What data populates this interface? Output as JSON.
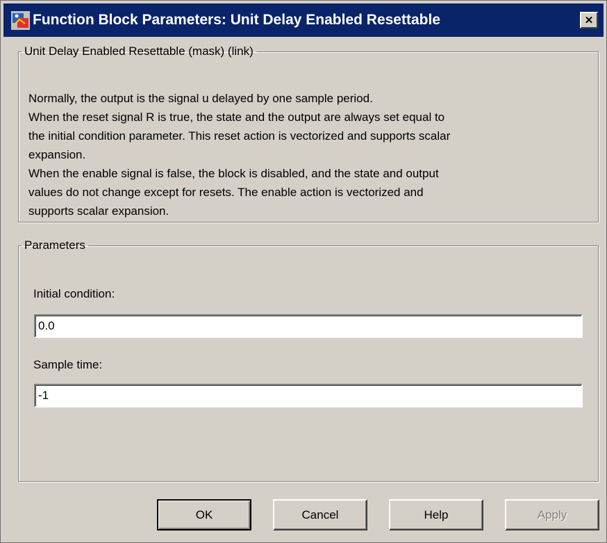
{
  "window": {
    "title": "Function Block Parameters: Unit Delay Enabled Resettable",
    "close_symbol": "✕"
  },
  "description_group": {
    "legend": "Unit Delay Enabled Resettable (mask) (link)",
    "lines": [
      "Normally, the output is the signal u delayed by one sample period.",
      "When the reset signal R is true, the state and the output are always set equal to",
      "the initial condition parameter.  This reset action is vectorized and supports scalar",
      "expansion.",
      "When the enable signal is false, the block is disabled, and the state and output",
      "values do not change except for resets.  The enable action is vectorized and",
      "supports scalar expansion."
    ]
  },
  "parameters_group": {
    "legend": "Parameters",
    "initial_condition": {
      "label": "Initial condition:",
      "value": "0.0"
    },
    "sample_time": {
      "label": "Sample time:",
      "value": "-1"
    }
  },
  "buttons": {
    "ok": "OK",
    "cancel": "Cancel",
    "help": "Help",
    "apply": "Apply"
  },
  "colors": {
    "titlebar": "#0a246a",
    "dialog_bg": "#d4d0c8"
  },
  "icons": {
    "app": "simulink-icon",
    "close": "close-icon"
  }
}
